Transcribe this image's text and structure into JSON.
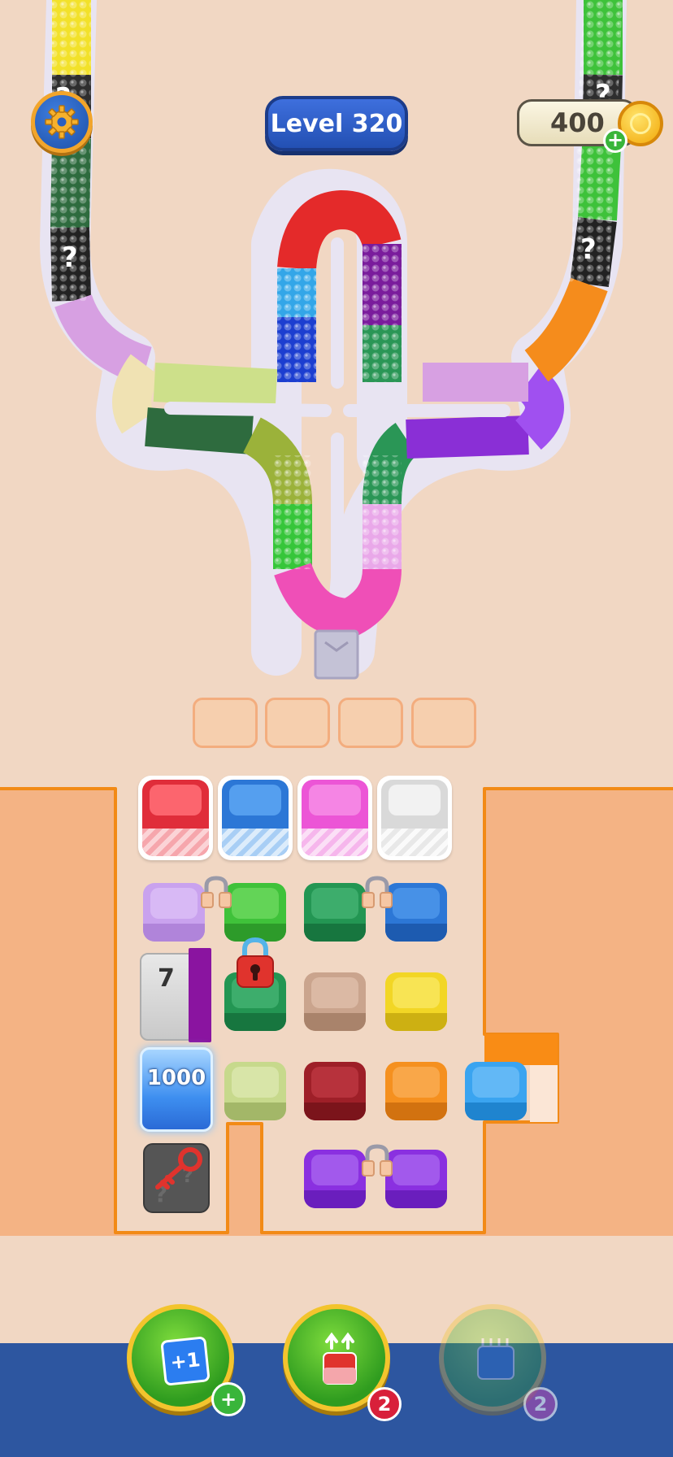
{
  "hud": {
    "level_label": "Level 320",
    "coins": "400",
    "coin_plus": "+",
    "track_unknown_mark": "?"
  },
  "slots": {
    "count": 4,
    "filled": 0
  },
  "board": {
    "lock_count": "7",
    "ice_count": "1000",
    "top_trays": [
      "#e02d3a",
      "#2c77d6",
      "#ec55d6",
      "#d9d9d9"
    ],
    "rows": [
      [
        "#c9a2ee",
        "#3fc23a",
        "#239653",
        "#2c77d6"
      ],
      [
        "#239653",
        "#caa48d",
        "#f2d625"
      ],
      [
        "#c7d98c",
        "#9e1f28",
        "#f5901f",
        "#3aa4f0"
      ],
      [
        "#8a30e0",
        "#8a30e0"
      ]
    ]
  },
  "boosters": [
    {
      "name": "add-slot",
      "icon_label": "+1",
      "badge": "+"
    },
    {
      "name": "lift",
      "badge": "2"
    },
    {
      "name": "shuffle",
      "badge": "2"
    }
  ],
  "colors": {
    "background": "#f1d7c3",
    "board": "#f4b384",
    "board_outline": "#f28a16",
    "bottom_bar": "#2d56a0"
  }
}
